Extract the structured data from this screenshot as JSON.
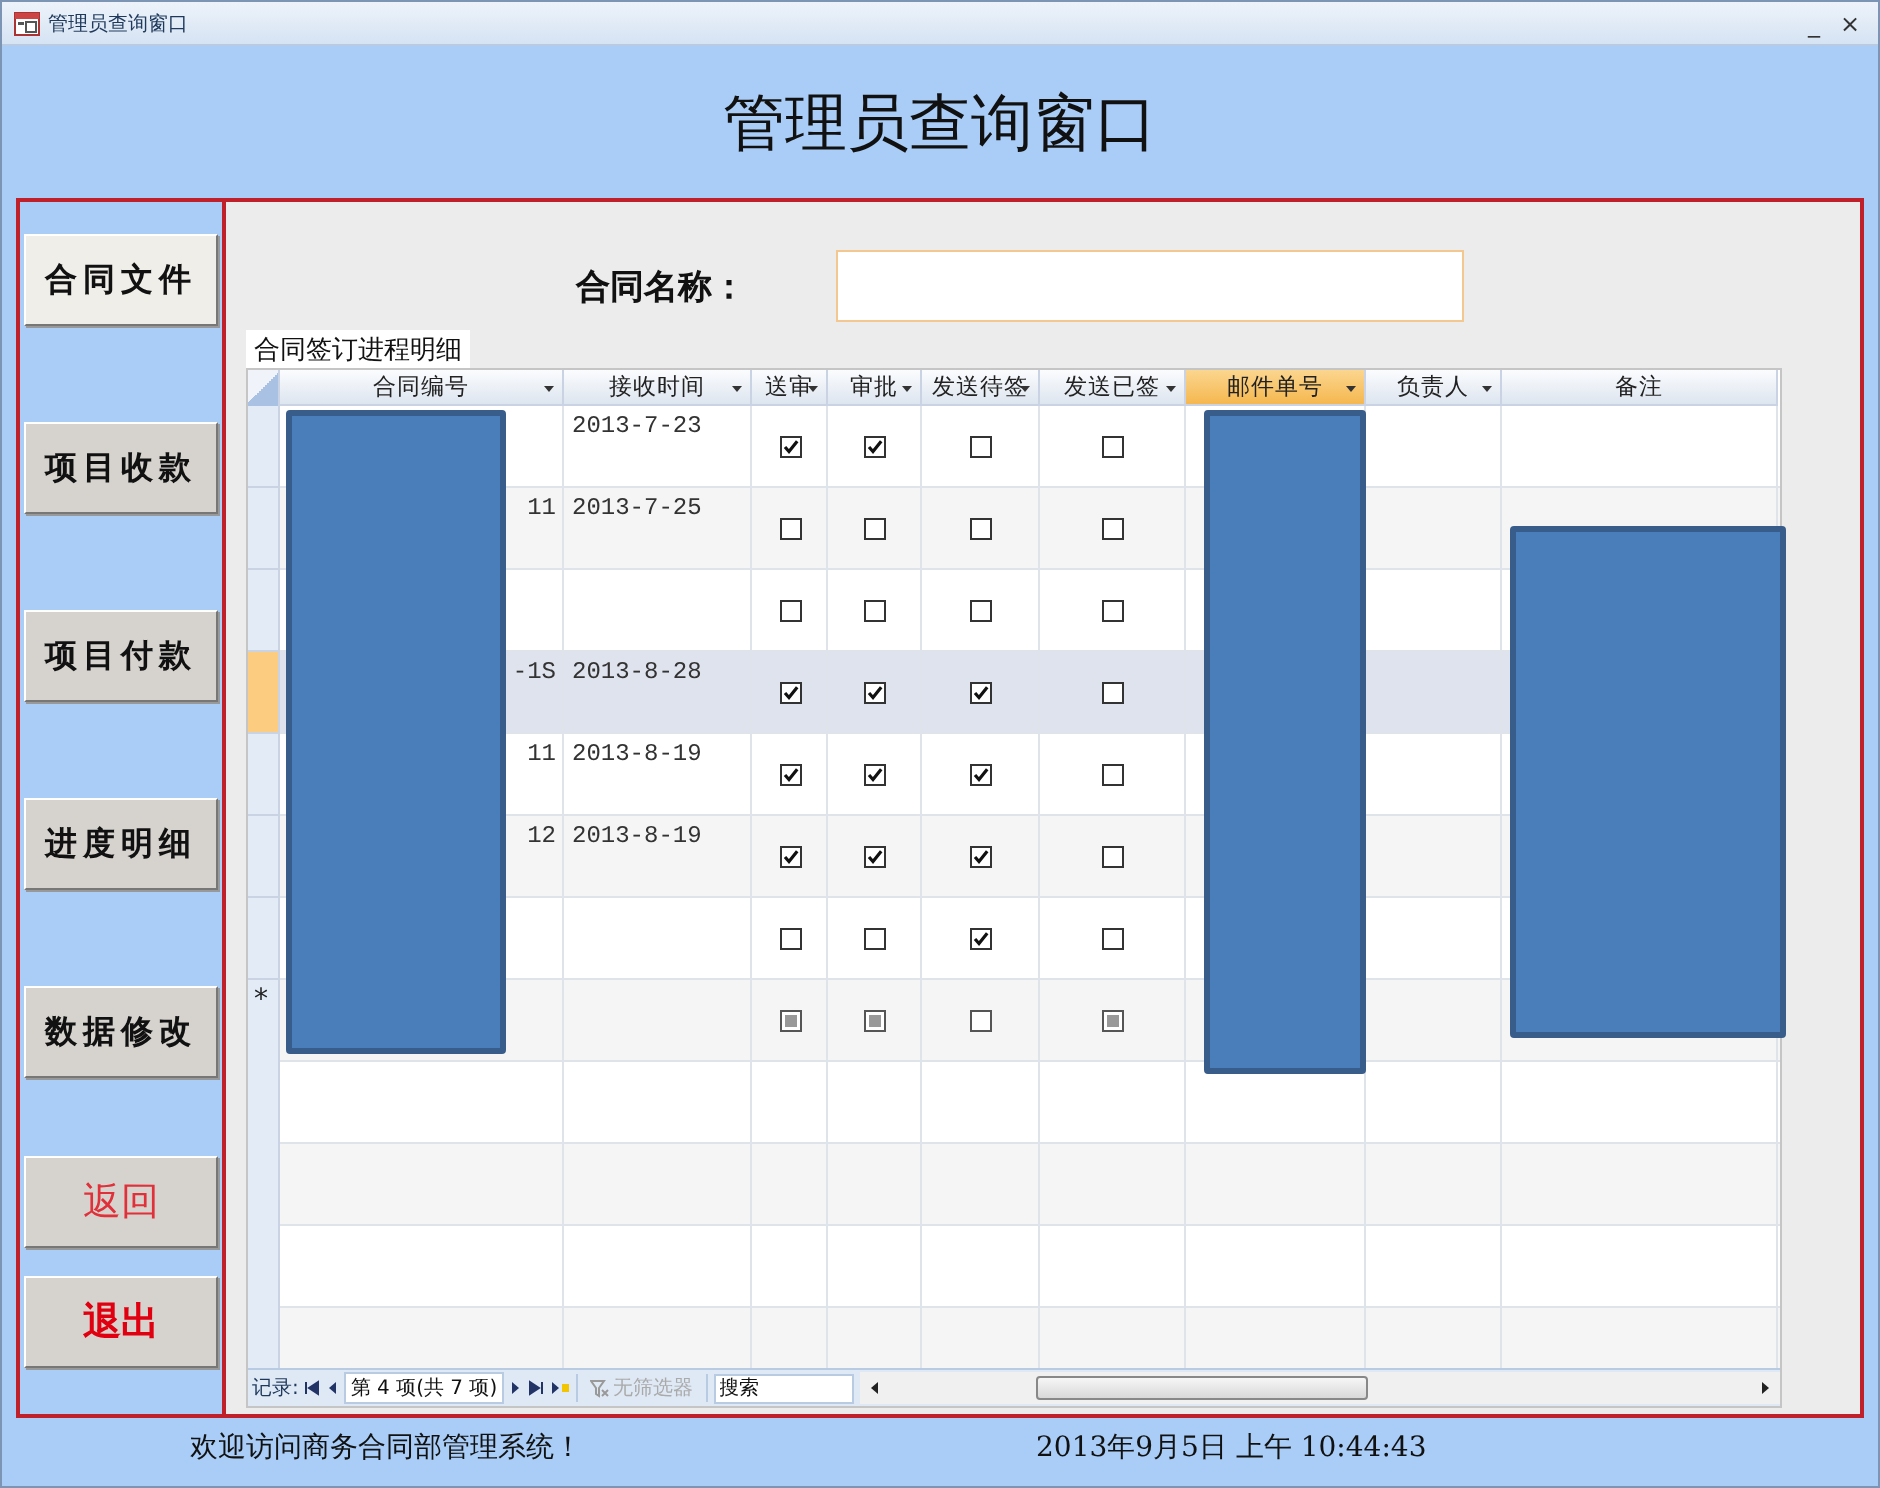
{
  "window": {
    "title": "管理员查询窗口",
    "controls": [
      "_",
      "×"
    ]
  },
  "heading": "管理员查询窗口",
  "sidebar": {
    "buttons": [
      {
        "label": "合同文件",
        "kind": "nav",
        "selected": true
      },
      {
        "label": "项目收款",
        "kind": "nav",
        "selected": false
      },
      {
        "label": "项目付款",
        "kind": "nav",
        "selected": false
      },
      {
        "label": "进度明细",
        "kind": "nav",
        "selected": false
      },
      {
        "label": "数据修改",
        "kind": "nav",
        "selected": false
      },
      {
        "label": "返回",
        "kind": "action",
        "selected": false
      },
      {
        "label": "退出",
        "kind": "exit",
        "selected": false
      }
    ]
  },
  "search_form": {
    "label": "合同名称："
  },
  "subform": {
    "caption": "合同签订进程明细",
    "columns": [
      {
        "label": "合同编号",
        "kind": "id",
        "dropdown": true,
        "selected": false
      },
      {
        "label": "接收时间",
        "kind": "date",
        "dropdown": true,
        "selected": false
      },
      {
        "label": "送审",
        "kind": "check",
        "dropdown": true,
        "selected": false
      },
      {
        "label": "审批",
        "kind": "check",
        "dropdown": true,
        "selected": false
      },
      {
        "label": "发送待签",
        "kind": "check",
        "dropdown": true,
        "selected": false
      },
      {
        "label": "发送已签",
        "kind": "check",
        "dropdown": true,
        "selected": false
      },
      {
        "label": "邮件单号",
        "kind": "blank",
        "dropdown": true,
        "selected": true
      },
      {
        "label": "负责人",
        "kind": "blank",
        "dropdown": true,
        "selected": false
      },
      {
        "label": "备注",
        "kind": "blank",
        "dropdown": false,
        "selected": false
      }
    ],
    "rows": [
      {
        "selected": false,
        "date": "2013-7-23",
        "checks": [
          true,
          true,
          false,
          false
        ]
      },
      {
        "selected": false,
        "id": "11",
        "date": "2013-7-25",
        "checks": [
          false,
          false,
          false,
          false
        ]
      },
      {
        "selected": false,
        "checks": [
          false,
          false,
          false,
          false
        ]
      },
      {
        "selected": true,
        "id": "-1S",
        "date": "2013-8-28",
        "checks": [
          true,
          true,
          true,
          false
        ]
      },
      {
        "selected": false,
        "id": "11",
        "date": "2013-8-19",
        "checks": [
          true,
          true,
          true,
          false
        ]
      },
      {
        "selected": false,
        "id": "12",
        "date": "2013-8-19",
        "checks": [
          true,
          true,
          true,
          false
        ]
      },
      {
        "selected": false,
        "checks": [
          false,
          false,
          true,
          false
        ]
      }
    ],
    "new_row": {
      "marker": "*",
      "greyed": [
        true,
        true,
        false,
        true
      ]
    },
    "navigator": {
      "label": "记录:",
      "position": "第 4 项(共 7 项)",
      "filter": "无筛选器",
      "search_placeholder": "搜索"
    }
  },
  "status_bar": {
    "welcome": "欢迎访问商务合同部管理系统！",
    "datetime": "2013年9月5日 上午  10:44:43"
  }
}
